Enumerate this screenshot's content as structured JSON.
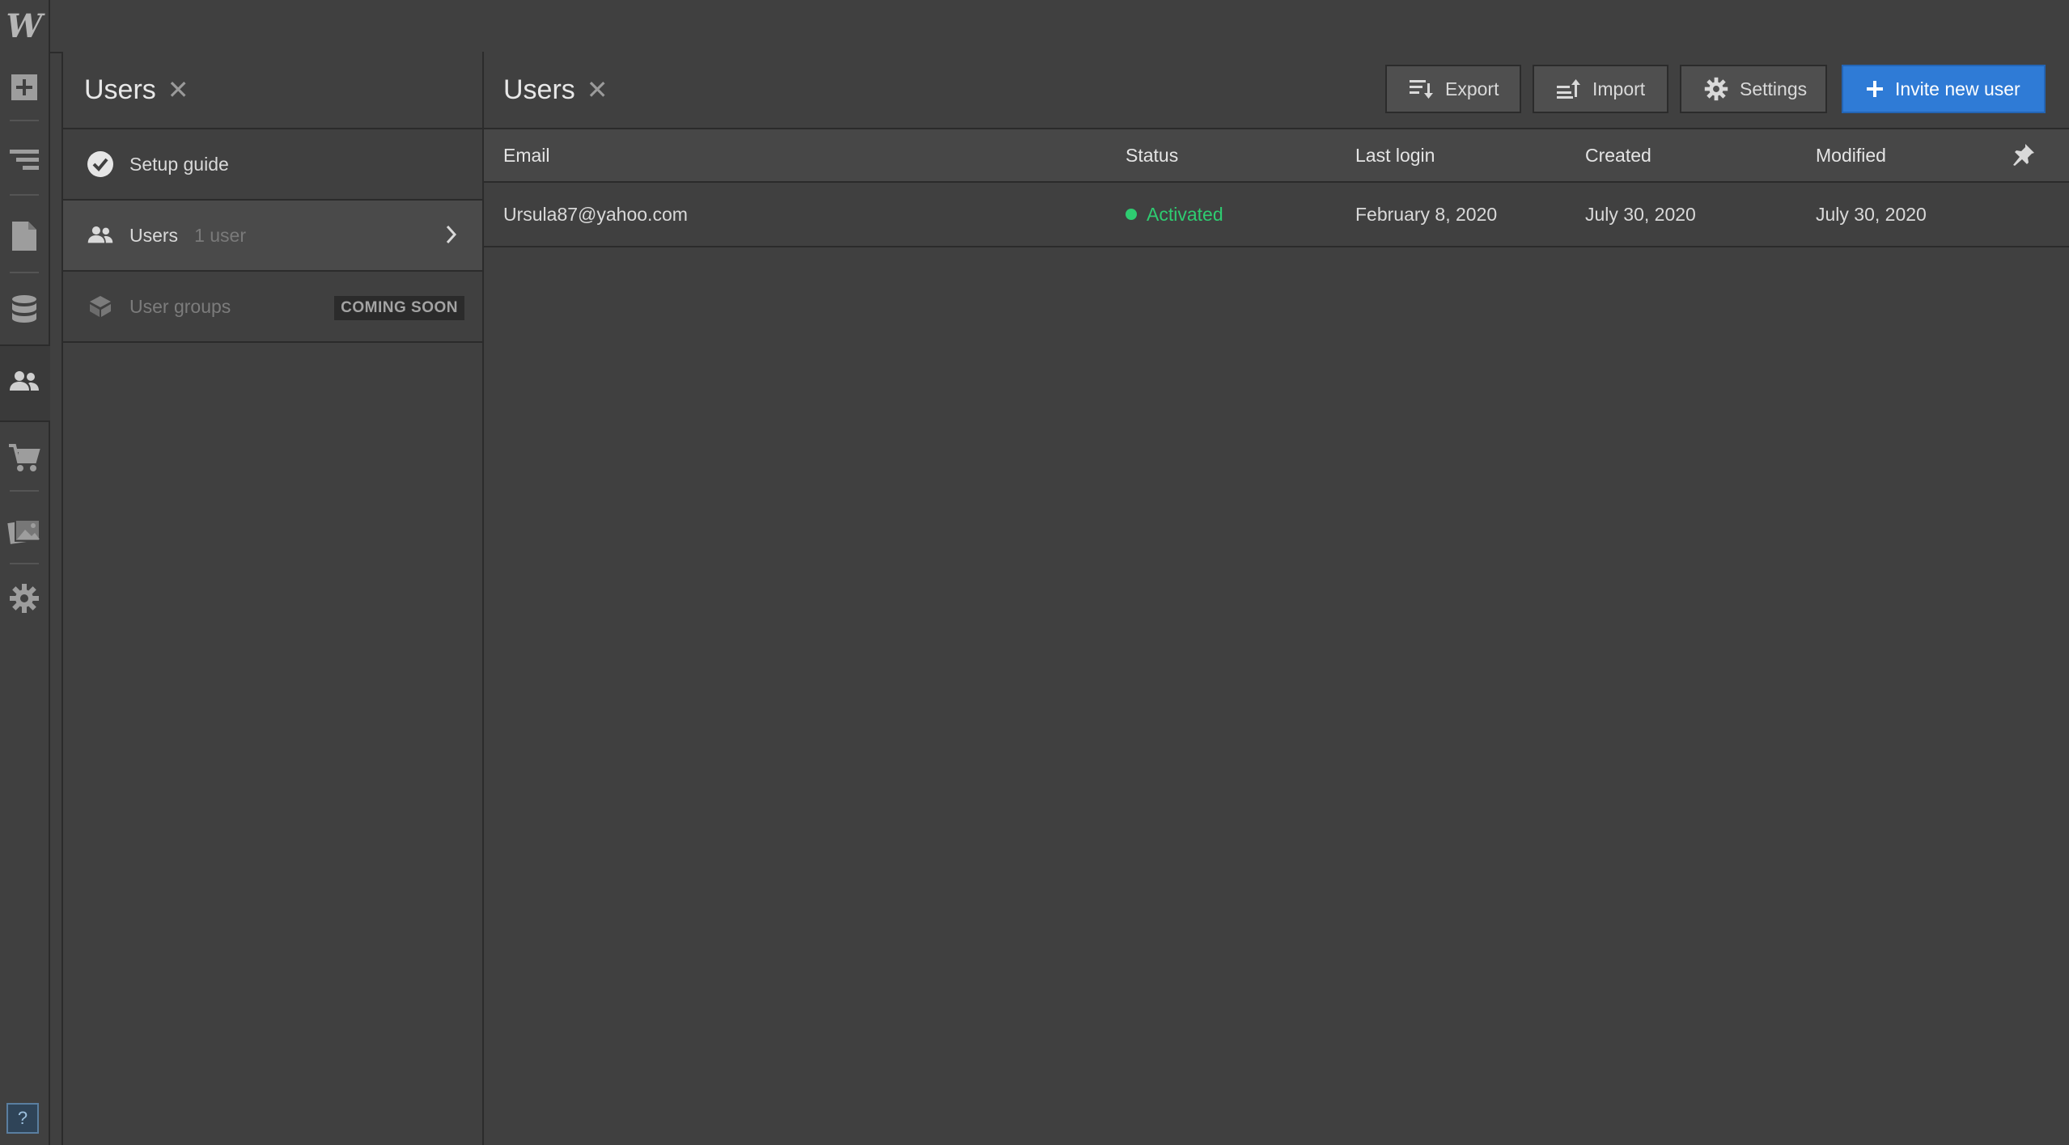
{
  "rail": {
    "logo": "W",
    "icons": [
      "add-icon",
      "navigator-icon",
      "pages-icon",
      "cms-icon",
      "users-icon",
      "ecommerce-icon",
      "assets-icon",
      "settings-icon"
    ],
    "help": "?"
  },
  "panel": {
    "title": "Users",
    "items": [
      {
        "label": "Setup guide"
      },
      {
        "label": "Users",
        "count": "1 user"
      },
      {
        "label": "User groups",
        "badge": "COMING SOON"
      }
    ]
  },
  "main": {
    "title": "Users",
    "buttons": {
      "export": "Export",
      "import": "Import",
      "settings": "Settings",
      "invite": "Invite new user"
    },
    "columns": [
      "Email",
      "Status",
      "Last login",
      "Created",
      "Modified"
    ],
    "rows": [
      {
        "email": "Ursula87@yahoo.com",
        "status": "Activated",
        "last_login": "February 8, 2020",
        "created": "July 30, 2020",
        "modified": "July 30, 2020"
      }
    ]
  },
  "colors": {
    "accent": "#2f7bd6",
    "status_active": "#2ecc71",
    "background": "#404040"
  }
}
